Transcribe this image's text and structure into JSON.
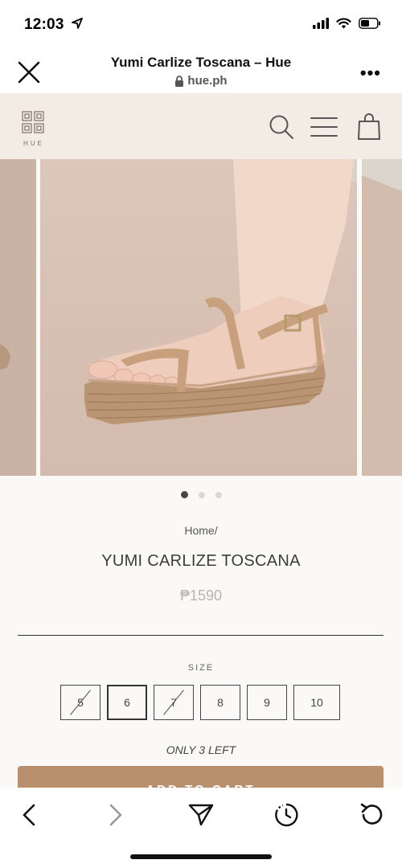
{
  "status": {
    "time": "12:03",
    "location_icon": "location-arrow-icon",
    "signal_icon": "cellular-signal-icon",
    "wifi_icon": "wifi-icon",
    "battery_icon": "battery-icon"
  },
  "browser": {
    "title": "Yumi Carlize Toscana – Hue",
    "url": "hue.ph",
    "more_label": "•••"
  },
  "site": {
    "logo_text": "HUE",
    "background": "#f2ece4"
  },
  "gallery": {
    "slide_count": 3,
    "active_slide": 1
  },
  "product": {
    "breadcrumb": "Home/",
    "name": "YUMI CARLIZE TOSCANA",
    "price": "₱1590",
    "size_label": "SIZE",
    "sizes": [
      {
        "label": "5",
        "sold_out": true,
        "selected": false
      },
      {
        "label": "6",
        "sold_out": false,
        "selected": true
      },
      {
        "label": "7",
        "sold_out": true,
        "selected": false
      },
      {
        "label": "8",
        "sold_out": false,
        "selected": false
      },
      {
        "label": "9",
        "sold_out": false,
        "selected": false
      },
      {
        "label": "10",
        "sold_out": false,
        "selected": false
      }
    ],
    "stock_note": "ONLY 3 LEFT",
    "add_to_cart_label": "ADD TO CART",
    "accent_color": "#b8906d"
  }
}
